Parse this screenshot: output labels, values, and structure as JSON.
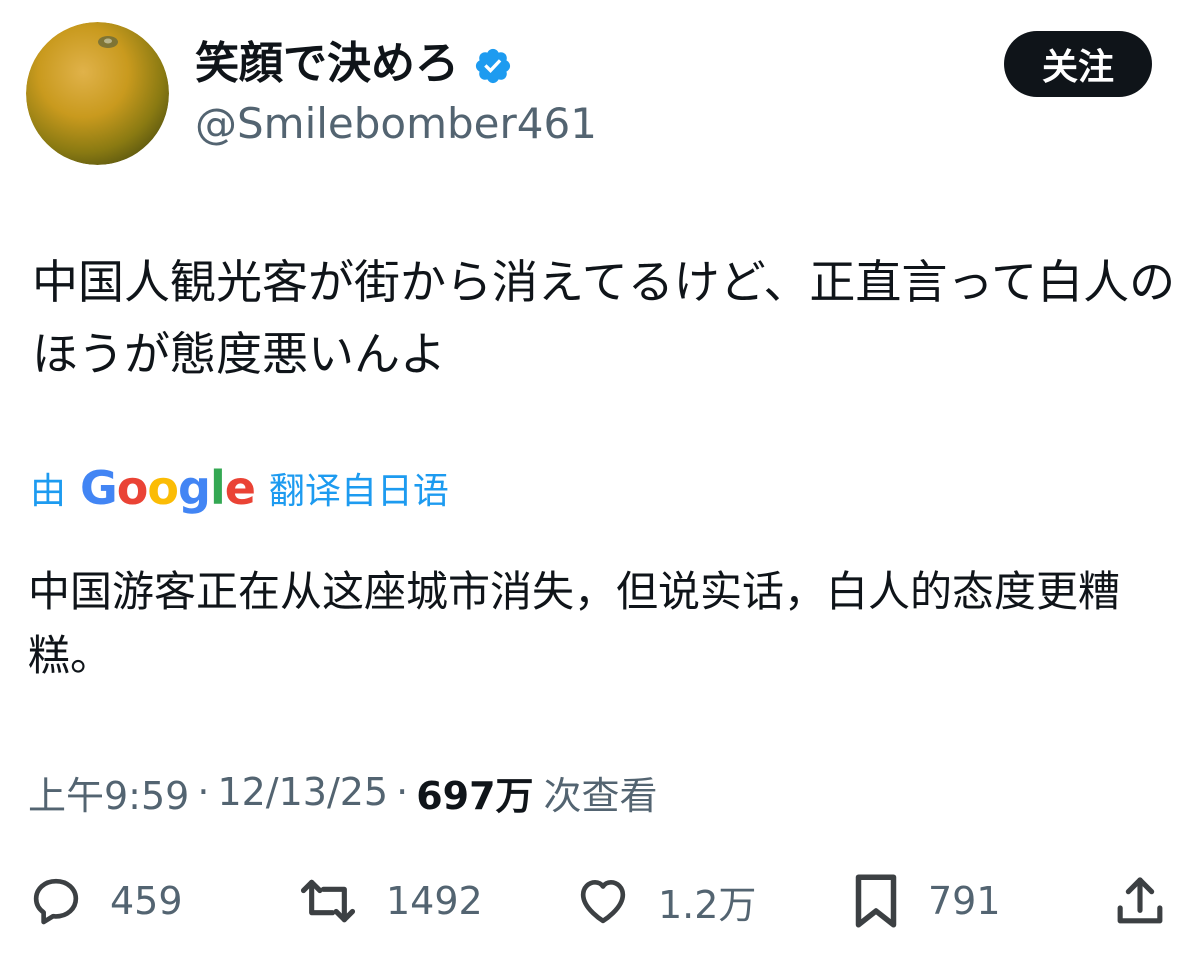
{
  "author": {
    "display_name": "笑顔で決めろ",
    "handle": "@Smilebomber461",
    "avatar": "orange-fruit-photo",
    "verified": true,
    "verified_color": "#1d9bf0"
  },
  "follow_button": {
    "label": "关注"
  },
  "tweet": {
    "text": "中国人観光客が街から消えてるけど、正直言って白人のほうが態度悪いんよ"
  },
  "translation": {
    "prefix": "由",
    "provider_logo": "Google",
    "suffix": "翻译自日语",
    "text": "中国游客正在从这座城市消失，但说实话，白人的态度更糟糕。"
  },
  "meta": {
    "time": "上午9:59",
    "separator": "·",
    "date": "12/13/25",
    "views_count": "697万",
    "views_label": "次查看"
  },
  "actions": {
    "reply": {
      "icon": "reply-icon",
      "count": "459"
    },
    "retweet": {
      "icon": "retweet-icon",
      "count": "1492"
    },
    "like": {
      "icon": "heart-icon",
      "count": "1.2万"
    },
    "bookmark": {
      "icon": "bookmark-icon",
      "count": "791"
    },
    "share": {
      "icon": "share-icon"
    }
  },
  "colors": {
    "text_primary": "#0f1419",
    "text_secondary": "#536471",
    "link": "#1d9bf0",
    "button_bg": "#0f1419"
  }
}
